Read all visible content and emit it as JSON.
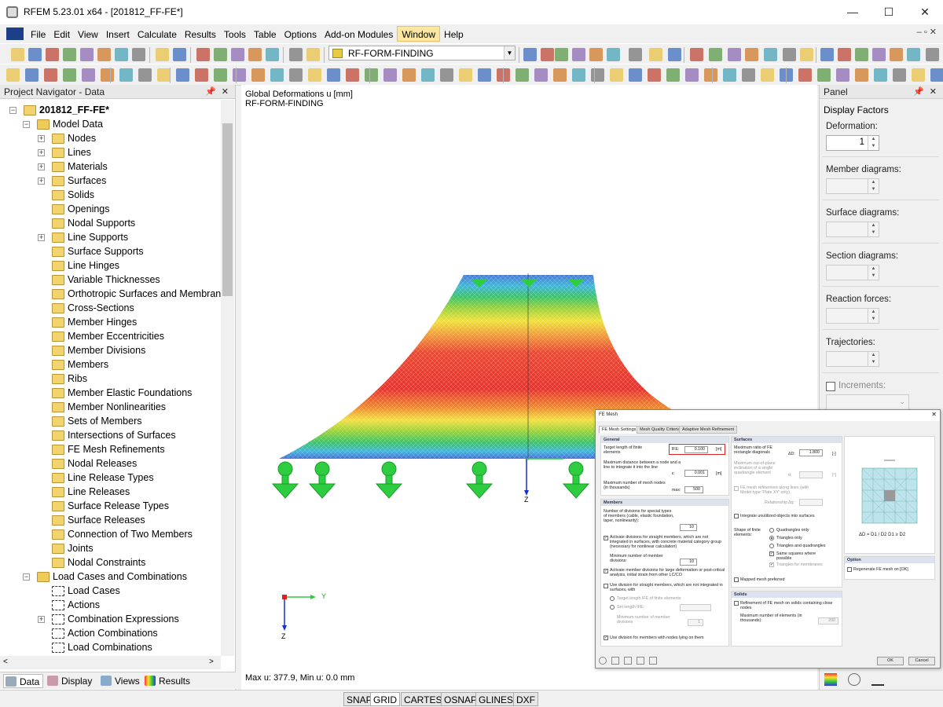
{
  "window": {
    "title": "RFEM 5.23.01 x64 - [201812_FF-FE*]",
    "minimize": "—",
    "maximize": "☐",
    "close": "✕"
  },
  "menu": [
    "File",
    "Edit",
    "View",
    "Insert",
    "Calculate",
    "Results",
    "Tools",
    "Table",
    "Options",
    "Add-on Modules",
    "Window",
    "Help"
  ],
  "menu_selected": "Window",
  "toolbar": {
    "loadcase": "RF-FORM-FINDING"
  },
  "navigator": {
    "title": "Project Navigator - Data",
    "root": "201812_FF-FE*",
    "items": [
      {
        "label": "Model Data",
        "level": 1,
        "exp": "-",
        "icon": "folder"
      },
      {
        "label": "Nodes",
        "level": 2,
        "exp": "+"
      },
      {
        "label": "Lines",
        "level": 2,
        "exp": "+"
      },
      {
        "label": "Materials",
        "level": 2,
        "exp": "+"
      },
      {
        "label": "Surfaces",
        "level": 2,
        "exp": "+"
      },
      {
        "label": "Solids",
        "level": 2,
        "exp": ""
      },
      {
        "label": "Openings",
        "level": 2,
        "exp": ""
      },
      {
        "label": "Nodal Supports",
        "level": 2,
        "exp": ""
      },
      {
        "label": "Line Supports",
        "level": 2,
        "exp": "+"
      },
      {
        "label": "Surface Supports",
        "level": 2,
        "exp": ""
      },
      {
        "label": "Line Hinges",
        "level": 2,
        "exp": ""
      },
      {
        "label": "Variable Thicknesses",
        "level": 2,
        "exp": ""
      },
      {
        "label": "Orthotropic Surfaces and Membrane",
        "level": 2,
        "exp": ""
      },
      {
        "label": "Cross-Sections",
        "level": 2,
        "exp": ""
      },
      {
        "label": "Member Hinges",
        "level": 2,
        "exp": ""
      },
      {
        "label": "Member Eccentricities",
        "level": 2,
        "exp": ""
      },
      {
        "label": "Member Divisions",
        "level": 2,
        "exp": ""
      },
      {
        "label": "Members",
        "level": 2,
        "exp": ""
      },
      {
        "label": "Ribs",
        "level": 2,
        "exp": ""
      },
      {
        "label": "Member Elastic Foundations",
        "level": 2,
        "exp": ""
      },
      {
        "label": "Member Nonlinearities",
        "level": 2,
        "exp": ""
      },
      {
        "label": "Sets of Members",
        "level": 2,
        "exp": ""
      },
      {
        "label": "Intersections of Surfaces",
        "level": 2,
        "exp": ""
      },
      {
        "label": "FE Mesh Refinements",
        "level": 2,
        "exp": ""
      },
      {
        "label": "Nodal Releases",
        "level": 2,
        "exp": ""
      },
      {
        "label": "Line Release Types",
        "level": 2,
        "exp": ""
      },
      {
        "label": "Line Releases",
        "level": 2,
        "exp": ""
      },
      {
        "label": "Surface Release Types",
        "level": 2,
        "exp": ""
      },
      {
        "label": "Surface Releases",
        "level": 2,
        "exp": ""
      },
      {
        "label": "Connection of Two Members",
        "level": 2,
        "exp": ""
      },
      {
        "label": "Joints",
        "level": 2,
        "exp": ""
      },
      {
        "label": "Nodal Constraints",
        "level": 2,
        "exp": ""
      },
      {
        "label": "Load Cases and Combinations",
        "level": 1,
        "exp": "-",
        "icon": "folder"
      },
      {
        "label": "Load Cases",
        "level": 2,
        "exp": "",
        "icon": "lc"
      },
      {
        "label": "Actions",
        "level": 2,
        "exp": "",
        "icon": "lc"
      },
      {
        "label": "Combination Expressions",
        "level": 2,
        "exp": "+",
        "icon": "lc"
      },
      {
        "label": "Action Combinations",
        "level": 2,
        "exp": "",
        "icon": "lc"
      },
      {
        "label": "Load Combinations",
        "level": 2,
        "exp": "",
        "icon": "lc"
      }
    ],
    "tabs": [
      "Data",
      "Display",
      "Views",
      "Results"
    ]
  },
  "view": {
    "title_line1": "Global Deformations u [mm]",
    "title_line2": "RF-FORM-FINDING",
    "footer": "Max u: 377.9, Min u: 0.0 mm",
    "axis_y": "Y",
    "axis_z": "Z"
  },
  "panel": {
    "title": "Panel",
    "section": "Display Factors",
    "fields": [
      {
        "label": "Deformation:",
        "value": "1",
        "enabled": true
      },
      {
        "label": "Member diagrams:",
        "value": "",
        "enabled": false
      },
      {
        "label": "Surface diagrams:",
        "value": "",
        "enabled": false
      },
      {
        "label": "Section diagrams:",
        "value": "",
        "enabled": false
      },
      {
        "label": "Reaction forces:",
        "value": "",
        "enabled": false
      },
      {
        "label": "Trajectories:",
        "value": "",
        "enabled": false
      }
    ],
    "increments": "Increments:"
  },
  "status": [
    "SNAP",
    "GRID",
    "CARTES",
    "OSNAP",
    "GLINES",
    "DXF"
  ],
  "dialog": {
    "title": "FE Mesh",
    "tabs": [
      "FE Mesh Settings",
      "Mesh Quality Criteria",
      "Adaptive Mesh Refinement"
    ],
    "general": "General",
    "target_len": "Target length of finite elements",
    "lfe": "lFE:",
    "lfe_val": "0.100",
    "unit_m": "[m]",
    "max_dist": "Maximum distance between a node and a line to integrate it into the line",
    "eps": "ε:",
    "eps_val": "0.001",
    "max_nodes": "Maximum number of mesh nodes (in thousands)",
    "max_label": "max:",
    "max_val": "500",
    "members": "Members",
    "num_div": "Number of divisions for special types of members (cable, elastic foundation, taper, nonlinearity):",
    "num_div_val": "10",
    "activate_div": "Activate divisions for straight members, which are not integrated in surfaces, with concrete material category group (necessary for nonlinear calculation)",
    "min_div": "Minimum number of member divisions:",
    "min_div_val": "10",
    "activate_large": "Activate member divisions for large deformation or post-critical analysis, initial strain from other LC/CO",
    "use_div": "Use division for straight members, which are not integrated in surfaces, with",
    "target_lfe": "Target length lFE of finite elements",
    "set_len": "Set length lFE:",
    "min_div2": "Minimum number of member divisions",
    "min_div2_val": "1",
    "use_nodes": "Use division for members with nodes lying on them",
    "surfaces": "Surfaces",
    "max_ratio": "Maximum ratio of FE rectangle diagonals",
    "dd": "ΔD:",
    "dd_val": "1.800",
    "unit_dash": "[-]",
    "max_oop": "Maximum out-of-plane inclination of a single quadrangle element",
    "alpha": "α:",
    "unit_deg": "[°]",
    "refine_lines": "FE mesh refinement along lines (with Model type 'Plate XY' only)",
    "relationship": "Relationship",
    "dq": "Δq:",
    "integrate": "Integrate unutilized objects into surfaces",
    "shape": "Shape of finite elements:",
    "shape_opts": [
      "Quadrangles only",
      "Triangles only",
      "Triangles and quadrangles",
      "Same squares where possible",
      "Triangles for membranes"
    ],
    "mapped": "Mapped mesh preferred",
    "solids": "Solids",
    "refine_solids": "Refinement of FE mesh on solids containing close nodes",
    "max_elem": "Maximum number of elements (in thousands):",
    "max_elem_val": "200",
    "option": "Option",
    "regen": "Regenerate FE mesh on [OK]",
    "formula": "ΔD = D1 / D2   D1 ≥ D2",
    "ok": "OK",
    "cancel": "Cancel"
  }
}
